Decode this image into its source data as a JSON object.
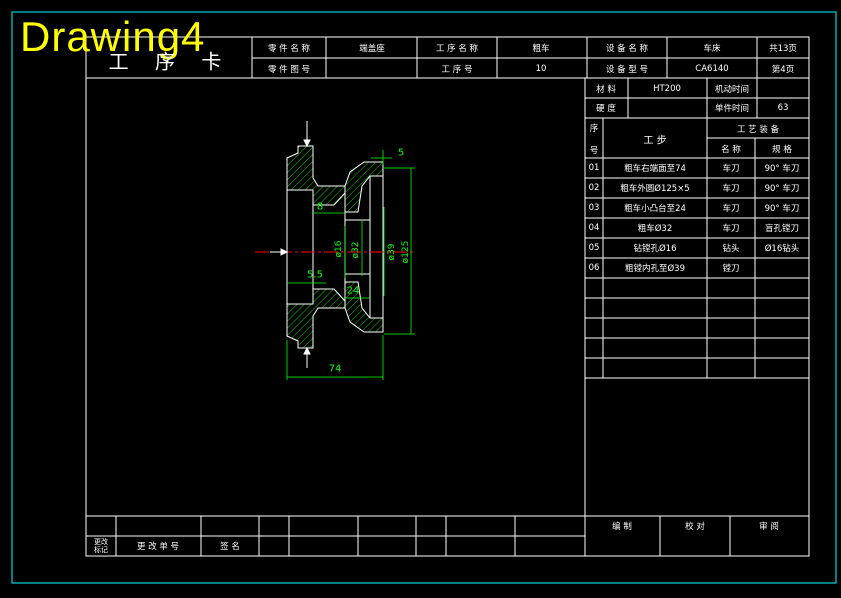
{
  "app": {
    "window_title": "Drawing4"
  },
  "title_block": {
    "card_title": "工 序 卡",
    "part_name_label": "零 件 名 称",
    "part_name": "端盖座",
    "part_no_label": "零 件 图 号",
    "part_no": "",
    "process_name_label": "工 序 名 称",
    "process_name": "粗车",
    "process_no_label": "工  序  号",
    "process_no": "10",
    "equip_name_label": "设 备 名 称",
    "equip_name": "车床",
    "equip_model_label": "设 备 型 号",
    "equip_model": "CA6140",
    "total_pages": "共13页",
    "page_no": "第4页"
  },
  "info_block": {
    "material_label": "材  料",
    "material": "HT200",
    "hardness_label": "硬  度",
    "hardness": "",
    "machine_time_label": "机动时间",
    "machine_time": "",
    "unit_time_label": "单件时间",
    "unit_time": "63"
  },
  "steps_table": {
    "seq_header_top": "序",
    "seq_header_bottom": "号",
    "step_header": "工     步",
    "equip_header": "工 艺 装 备",
    "name_header": "名  称",
    "spec_header": "规  格",
    "rows": [
      {
        "no": "01",
        "step": "粗车右端面至74",
        "name": "车刀",
        "spec": "90° 车刀"
      },
      {
        "no": "02",
        "step": "粗车外圆Ø125×5",
        "name": "车刀",
        "spec": "90° 车刀"
      },
      {
        "no": "03",
        "step": "粗车小凸台至24",
        "name": "车刀",
        "spec": "90° 车刀"
      },
      {
        "no": "04",
        "step": "粗车Ø32",
        "name": "车刀",
        "spec": "盲孔镗刀"
      },
      {
        "no": "05",
        "step": "钻镗孔Ø16",
        "name": "钻头",
        "spec": "Ø16钻头"
      },
      {
        "no": "06",
        "step": "粗镗内孔至Ø39",
        "name": "镗刀",
        "spec": ""
      }
    ]
  },
  "bottom_block": {
    "change_mark": "更改标记",
    "change_doc": "更  改  单  号",
    "signature": "签  名",
    "compile": "编     制",
    "check": "校     对",
    "review": "审     阅"
  },
  "dimensions": {
    "d5": "5",
    "d8": "8",
    "d5_5": "5.5",
    "d24": "24",
    "d74": "74",
    "phi16": "ø16",
    "phi32": "ø32",
    "phi39": "ø39",
    "phi125": "ø125"
  },
  "colors": {
    "background": "#000000",
    "lines": "#ffffff",
    "frame": "#00ffff",
    "hatch": "#00ff00",
    "dimension": "#00ff00",
    "centerline": "#ff0000",
    "watermark": "#ffff00"
  }
}
